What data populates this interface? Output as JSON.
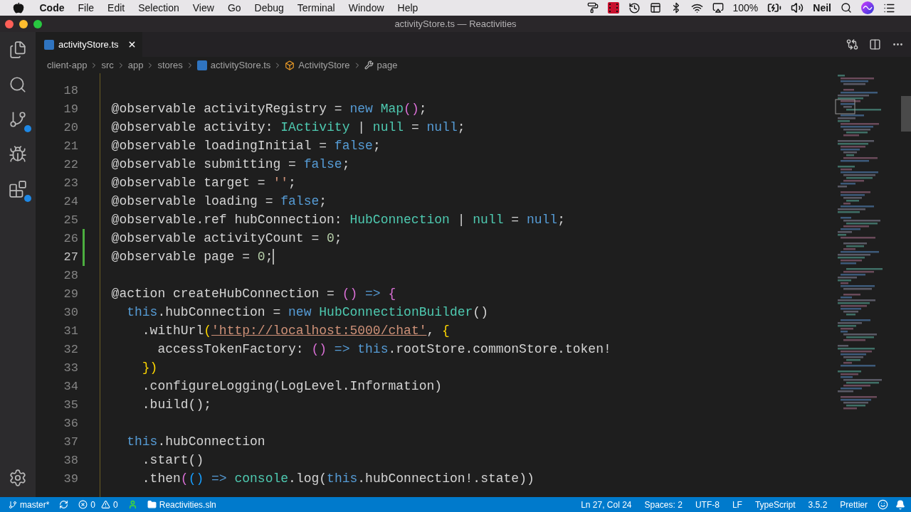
{
  "menu_bar": {
    "app_name": "Code",
    "items": [
      "File",
      "Edit",
      "Selection",
      "View",
      "Go",
      "Debug",
      "Terminal",
      "Window",
      "Help"
    ],
    "battery": "100%",
    "user": "Neil"
  },
  "window": {
    "title": "activityStore.ts — Reactivities"
  },
  "activity_bar": {
    "items": [
      {
        "kind": "explorer",
        "badge": false
      },
      {
        "kind": "search",
        "badge": false
      },
      {
        "kind": "source_control",
        "badge": true
      },
      {
        "kind": "debug",
        "badge": false
      },
      {
        "kind": "extensions",
        "badge": true
      }
    ]
  },
  "tabs": [
    {
      "label": "activityStore.ts",
      "selected": true
    }
  ],
  "breadcrumbs": [
    {
      "kind": "folder",
      "label": "client-app"
    },
    {
      "kind": "folder",
      "label": "src"
    },
    {
      "kind": "folder",
      "label": "app"
    },
    {
      "kind": "folder",
      "label": "stores"
    },
    {
      "kind": "file",
      "label": "activityStore.ts"
    },
    {
      "kind": "class",
      "label": "ActivityStore"
    },
    {
      "kind": "property",
      "label": "page"
    }
  ],
  "editor": {
    "lines": [
      {
        "number": "18",
        "active": false,
        "added": false
      },
      {
        "number": "19",
        "active": false,
        "added": false,
        "tokens": [
          {
            "kind": "plain",
            "text": "  @observable activityRegistry = "
          },
          {
            "kind": "keyword",
            "text": "new "
          },
          {
            "kind": "type",
            "text": "Map"
          },
          {
            "kind": "bracket_b",
            "text": "()"
          },
          {
            "kind": "plain",
            "text": ";"
          }
        ]
      },
      {
        "number": "20",
        "active": false,
        "added": false,
        "tokens": [
          {
            "kind": "plain",
            "text": "  @observable activity: "
          },
          {
            "kind": "type",
            "text": "IActivity"
          },
          {
            "kind": "plain",
            "text": " | "
          },
          {
            "kind": "type",
            "text": "null"
          },
          {
            "kind": "plain",
            "text": " = "
          },
          {
            "kind": "keyword",
            "text": "null"
          },
          {
            "kind": "plain",
            "text": ";"
          }
        ]
      },
      {
        "number": "21",
        "active": false,
        "added": false,
        "tokens": [
          {
            "kind": "plain",
            "text": "  @observable loadingInitial = "
          },
          {
            "kind": "keyword",
            "text": "false"
          },
          {
            "kind": "plain",
            "text": ";"
          }
        ]
      },
      {
        "number": "22",
        "active": false,
        "added": false,
        "tokens": [
          {
            "kind": "plain",
            "text": "  @observable submitting = "
          },
          {
            "kind": "keyword",
            "text": "false"
          },
          {
            "kind": "plain",
            "text": ";"
          }
        ]
      },
      {
        "number": "23",
        "active": false,
        "added": false,
        "tokens": [
          {
            "kind": "plain",
            "text": "  @observable target = "
          },
          {
            "kind": "string",
            "text": "''"
          },
          {
            "kind": "plain",
            "text": ";"
          }
        ]
      },
      {
        "number": "24",
        "active": false,
        "added": false,
        "tokens": [
          {
            "kind": "plain",
            "text": "  @observable loading = "
          },
          {
            "kind": "keyword",
            "text": "false"
          },
          {
            "kind": "plain",
            "text": ";"
          }
        ]
      },
      {
        "number": "25",
        "active": false,
        "added": false,
        "tokens": [
          {
            "kind": "plain",
            "text": "  @observable.ref hubConnection: "
          },
          {
            "kind": "type",
            "text": "HubConnection"
          },
          {
            "kind": "plain",
            "text": " | "
          },
          {
            "kind": "type",
            "text": "null"
          },
          {
            "kind": "plain",
            "text": " = "
          },
          {
            "kind": "keyword",
            "text": "null"
          },
          {
            "kind": "plain",
            "text": ";"
          }
        ]
      },
      {
        "number": "26",
        "active": false,
        "added": true,
        "tokens": [
          {
            "kind": "plain",
            "text": "  @observable activityCount = "
          },
          {
            "kind": "number",
            "text": "0"
          },
          {
            "kind": "plain",
            "text": ";"
          }
        ]
      },
      {
        "number": "27",
        "active": true,
        "added": true,
        "tokens": [
          {
            "kind": "plain",
            "text": "  @observable page = "
          },
          {
            "kind": "number",
            "text": "0"
          },
          {
            "kind": "plain",
            "text": ";"
          }
        ]
      },
      {
        "number": "28",
        "active": false,
        "added": false
      },
      {
        "number": "29",
        "active": false,
        "added": false,
        "tokens": [
          {
            "kind": "plain",
            "text": "  @action createHubConnection = "
          },
          {
            "kind": "bracket_b",
            "text": "()"
          },
          {
            "kind": "keyword",
            "text": " => "
          },
          {
            "kind": "bracket_b",
            "text": "{"
          }
        ]
      },
      {
        "number": "30",
        "active": false,
        "added": false,
        "tokens": [
          {
            "kind": "keyword",
            "text": "    this"
          },
          {
            "kind": "plain",
            "text": ".hubConnection = "
          },
          {
            "kind": "keyword",
            "text": "new "
          },
          {
            "kind": "type",
            "text": "HubConnectionBuilder"
          },
          {
            "kind": "plain",
            "text": "()"
          }
        ]
      },
      {
        "number": "31",
        "active": false,
        "added": false,
        "tokens": [
          {
            "kind": "plain",
            "text": "      .withUrl"
          },
          {
            "kind": "bracket_a",
            "text": "("
          },
          {
            "kind": "url",
            "text": "'http://localhost:5000/chat'"
          },
          {
            "kind": "plain",
            "text": ", "
          },
          {
            "kind": "bracket_a",
            "text": "{"
          }
        ]
      },
      {
        "number": "32",
        "active": false,
        "added": false,
        "tokens": [
          {
            "kind": "plain",
            "text": "        accessTokenFactory: "
          },
          {
            "kind": "bracket_b",
            "text": "()"
          },
          {
            "kind": "keyword",
            "text": " => this"
          },
          {
            "kind": "plain",
            "text": ".rootStore.commonStore.token!"
          }
        ]
      },
      {
        "number": "33",
        "active": false,
        "added": false,
        "tokens": [
          {
            "kind": "bracket_a",
            "text": "      })"
          }
        ]
      },
      {
        "number": "34",
        "active": false,
        "added": false,
        "tokens": [
          {
            "kind": "plain",
            "text": "      .configureLogging(LogLevel.Information)"
          }
        ]
      },
      {
        "number": "35",
        "active": false,
        "added": false,
        "tokens": [
          {
            "kind": "plain",
            "text": "      .build();"
          }
        ]
      },
      {
        "number": "36",
        "active": false,
        "added": false
      },
      {
        "number": "37",
        "active": false,
        "added": false,
        "tokens": [
          {
            "kind": "keyword",
            "text": "    this"
          },
          {
            "kind": "plain",
            "text": ".hubConnection"
          }
        ]
      },
      {
        "number": "38",
        "active": false,
        "added": false,
        "tokens": [
          {
            "kind": "plain",
            "text": "      .start()"
          }
        ]
      },
      {
        "number": "39",
        "active": false,
        "added": false,
        "tokens": [
          {
            "kind": "plain",
            "text": "      .then"
          },
          {
            "kind": "bracket_b",
            "text": "("
          },
          {
            "kind": "bracket_c",
            "text": "()"
          },
          {
            "kind": "keyword",
            "text": " => "
          },
          {
            "kind": "type",
            "text": "console"
          },
          {
            "kind": "plain",
            "text": ".log("
          },
          {
            "kind": "keyword",
            "text": "this"
          },
          {
            "kind": "plain",
            "text": ".hubConnection!.state))"
          }
        ]
      }
    ]
  },
  "status_bar": {
    "branch": "master*",
    "errors": "0",
    "warnings": "0",
    "workspace": "Reactivities.sln",
    "right_items": [
      "Ln 27, Col 24",
      "Spaces: 2",
      "UTF-8",
      "LF",
      "TypeScript",
      "3.5.2",
      "Prettier"
    ]
  }
}
